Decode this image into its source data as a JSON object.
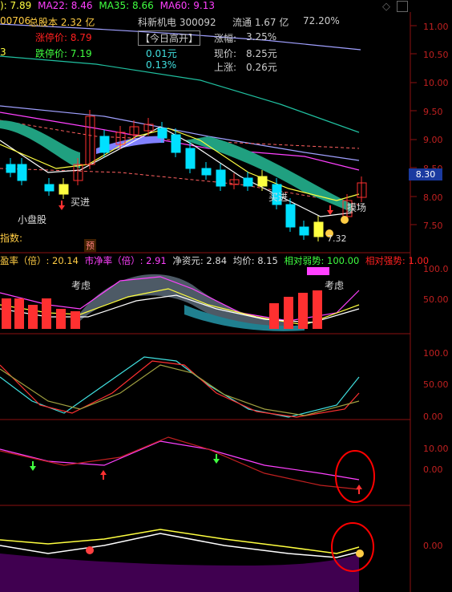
{
  "header": {
    "ma_prefix": "): 7.89",
    "ma22": "MA22: 8.46",
    "ma35": "MA35: 8.66",
    "ma60": "MA60: 9.13",
    "code_left": "00706",
    "total_shares": "总股本 2.32 亿",
    "limit_down": "跌停价: 7.19",
    "limit_up_label": "涨停价: 8.79",
    "left_marker": "3"
  },
  "stock_info": {
    "name_code": "科新机电  300092",
    "float_shares": "流通 1.67 亿",
    "float_pct": "72.20%",
    "today_open": "【今日高开】",
    "open_amt": "0.01元",
    "open_pct": "0.13%",
    "change_pct_label": "涨幅:",
    "change_pct": "3.25%",
    "price_label": "现价:",
    "price": "8.25元",
    "rise_label": "上涨:",
    "rise": "0.26元"
  },
  "main_panel": {
    "y_ticks": [
      "11.00",
      "10.50",
      "10.00",
      "9.50",
      "9.00",
      "8.50",
      "8.00",
      "7.50"
    ],
    "current_price_tag": "8.30",
    "small_cap_label": "小盘股",
    "index_label": "指数:",
    "pre_badge": "预",
    "buy_in_1": "买进",
    "buy_in_2": "买进",
    "stop_label": "摸场",
    "low_price_label": "7.32"
  },
  "indicator_header": {
    "pe_label": "盈率（倍）",
    "pe_value": ": 20.14",
    "pb_label": "市净率（倍）",
    "pb_value": ": 2.91",
    "nav": "净资元: 2.84",
    "avg_price": "均价: 8.15",
    "relative_strength": "相对弱势: 100.00",
    "relative_strength2": "相对强势: 1.00"
  },
  "panel2": {
    "y_ticks": [
      "100.0",
      "50.00"
    ],
    "consider_1": "考虑",
    "consider_2": "考虑"
  },
  "panel3": {
    "y_ticks": [
      "100.0",
      "50.00",
      "0.00"
    ]
  },
  "panel4": {
    "y_ticks": [
      "10.00",
      "0.00"
    ]
  },
  "panel5": {
    "y_ticks": [
      "0.00"
    ]
  },
  "colors": {
    "up": "#ff3030",
    "down": "#00e0ff",
    "grid": "#8b1010",
    "axis_text": "#c02020",
    "teal_band": "#20a080",
    "purple_band": "#8080ff"
  }
}
